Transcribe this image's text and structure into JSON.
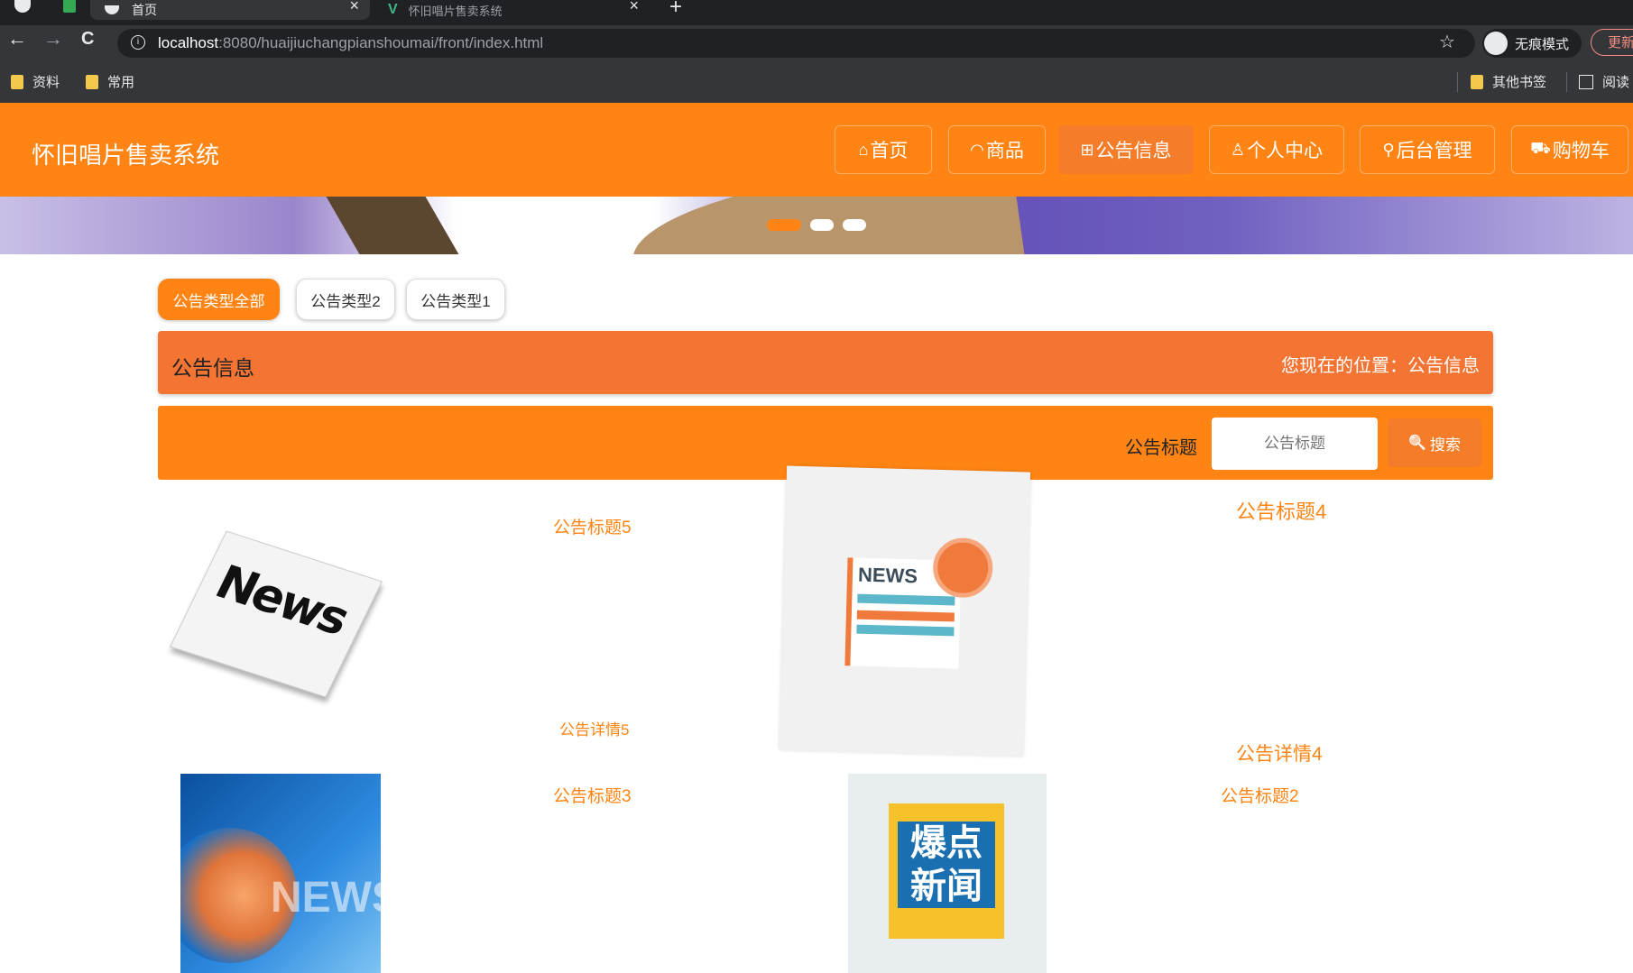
{
  "browser": {
    "tabs": [
      {
        "title": "首页",
        "close": "×"
      },
      {
        "title": "怀旧唱片售卖系统",
        "close": "×"
      }
    ],
    "new_tab": "+",
    "nav": {
      "back": "←",
      "forward": "→",
      "reload": "C"
    },
    "url_host": "localhost",
    "url_path": ":8080/huaijiuchangpianshoumai/front/index.html",
    "star": "☆",
    "incognito_label": "无痕模式",
    "update_label": "更新",
    "bookmarks": [
      "资料",
      "常用"
    ],
    "other_bookmarks": "其他书签",
    "reading_list": "阅读"
  },
  "site": {
    "title": "怀旧唱片售卖系统",
    "nav": [
      {
        "icon": "⌂",
        "label": "首页"
      },
      {
        "icon": "◠",
        "label": "商品"
      },
      {
        "icon": "⊞",
        "label": "公告信息"
      },
      {
        "icon": "♙",
        "label": "个人中心"
      },
      {
        "icon": "⚲",
        "label": "后台管理"
      },
      {
        "icon": "⛟",
        "label": "购物车"
      }
    ],
    "active_nav": "公告信息"
  },
  "filters": [
    "公告类型全部",
    "公告类型2",
    "公告类型1"
  ],
  "section": {
    "title": "公告信息",
    "breadcrumb": "您现在的位置：公告信息"
  },
  "search": {
    "label": "公告标题",
    "placeholder": "公告标题",
    "button": "搜索",
    "button_icon": "🔍"
  },
  "notices": [
    {
      "title": "公告标题5",
      "detail": "公告详情5",
      "image_text": "News"
    },
    {
      "title": "公告标题4",
      "detail": "公告详情4",
      "image_text": "NEWS"
    },
    {
      "title": "公告标题3",
      "image_text": "NEWS"
    },
    {
      "title": "公告标题2",
      "image_text": "爆点新闻"
    }
  ],
  "colors": {
    "primary": "#ff8413",
    "section_bar": "#f37433",
    "active_nav": "#f57c28"
  }
}
